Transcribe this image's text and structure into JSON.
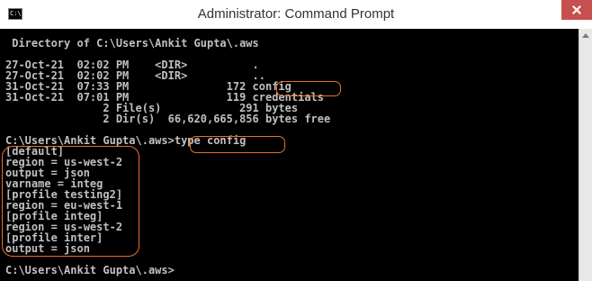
{
  "window": {
    "title": "Administrator: Command Prompt",
    "icon_text": "C:\\."
  },
  "console": {
    "lines": [
      " Directory of C:\\Users\\Ankit Gupta\\.aws",
      "",
      "27-Oct-21  02:02 PM    <DIR>          .",
      "27-Oct-21  02:02 PM    <DIR>          ..",
      "31-Oct-21  07:33 PM               172 config",
      "31-Oct-21  07:01 PM               119 credentials",
      "               2 File(s)            291 bytes",
      "               2 Dir(s)  66,620,665,856 bytes free",
      "",
      "C:\\Users\\Ankit Gupta\\.aws>type config",
      "[default]",
      "region = us-west-2",
      "output = json",
      "varname = integ",
      "[profile testing2]",
      "region = eu-west-1",
      "[profile integ]",
      "region = us-west-2",
      "[profile inter]",
      "output = json",
      "",
      "C:\\Users\\Ankit Gupta\\.aws>"
    ]
  },
  "annotations": {
    "color": "#e8702a"
  },
  "icons": {
    "app": "command-prompt-icon",
    "close": "close-icon",
    "scroll_up": "scroll-up-arrow-icon"
  }
}
